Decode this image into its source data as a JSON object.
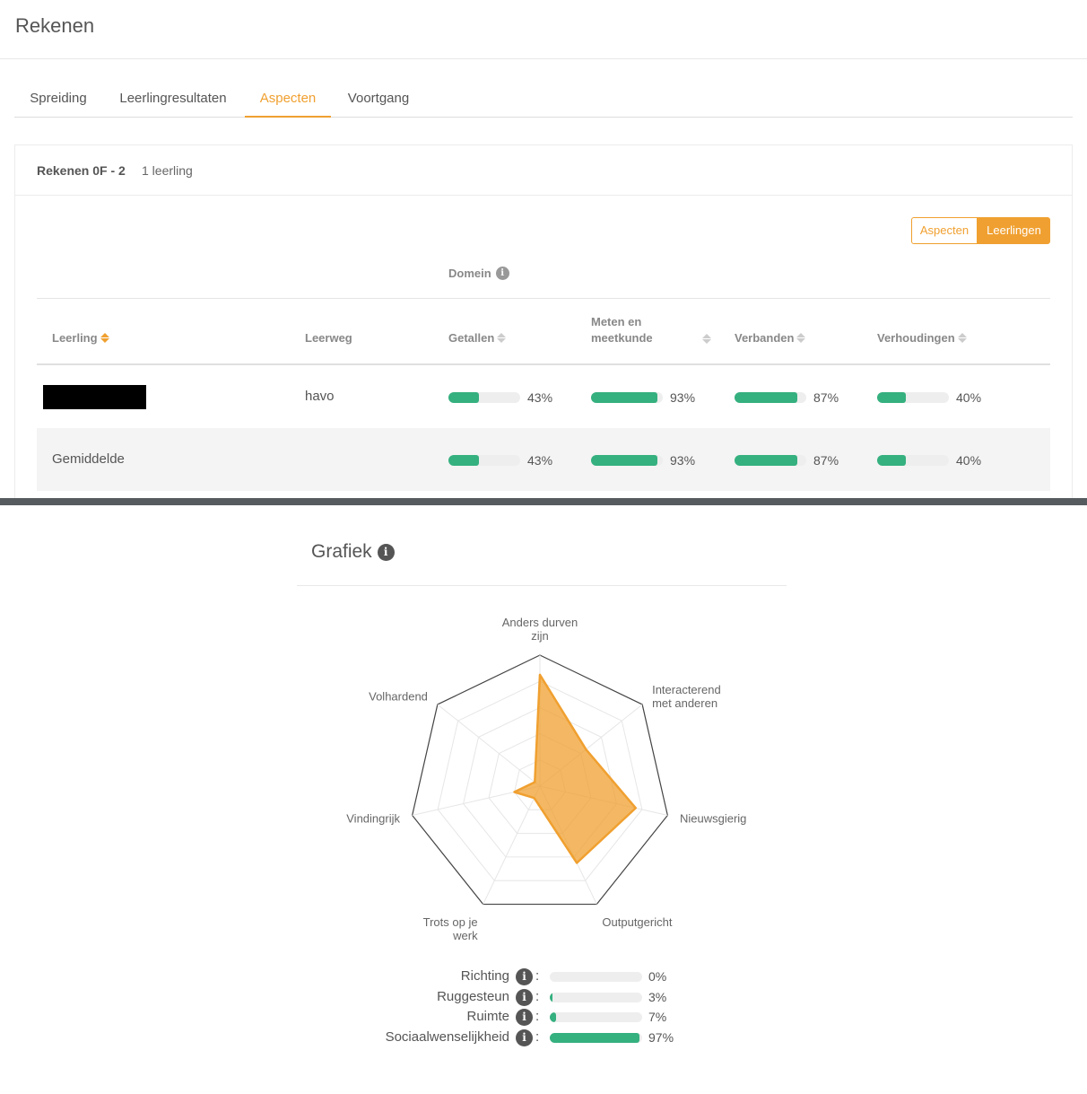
{
  "app": {
    "title": "Rekenen"
  },
  "tabs": [
    {
      "label": "Spreiding",
      "active": false
    },
    {
      "label": "Leerlingresultaten",
      "active": false
    },
    {
      "label": "Aspecten",
      "active": true
    },
    {
      "label": "Voortgang",
      "active": false
    }
  ],
  "card": {
    "title": "Rekenen 0F - 2",
    "subtitle": "1 leerling",
    "toggle": {
      "left": "Aspecten",
      "right": "Leerlingen",
      "selected": "Leerlingen"
    },
    "domein_label": "Domein",
    "columns": {
      "leerling": "Leerling",
      "leerweg": "Leerweg",
      "getallen": "Getallen",
      "meten": "Meten en meetkunde",
      "verbanden": "Verbanden",
      "verhoudingen": "Verhoudingen"
    },
    "rows": [
      {
        "name": "",
        "redacted": true,
        "leerweg": "havo",
        "getallen": 43,
        "meten": 93,
        "verbanden": 87,
        "verhoudingen": 40,
        "getallen_text": "43%",
        "meten_text": "93%",
        "verbanden_text": "87%",
        "verhoudingen_text": "40%"
      },
      {
        "name": "Gemiddelde",
        "redacted": false,
        "leerweg": "",
        "getallen": 43,
        "meten": 93,
        "verbanden": 87,
        "verhoudingen": 40,
        "getallen_text": "43%",
        "meten_text": "93%",
        "verbanden_text": "87%",
        "verhoudingen_text": "40%"
      }
    ]
  },
  "grafiek": {
    "title": "Grafiek",
    "chart_data": {
      "type": "radar",
      "axes": [
        "Anders durven zijn",
        "Interacterend met anderen",
        "Nieuwsgierig",
        "Outputgericht",
        "Trots op je werk",
        "Vindingrijk",
        "Volhardend"
      ],
      "axis_labels": [
        [
          "Anders durven",
          "zijn"
        ],
        [
          "Interacterend",
          "met anderen"
        ],
        [
          "Nieuwsgierig"
        ],
        [
          "Outputgericht"
        ],
        [
          "Trots op je",
          "werk"
        ],
        [
          "Vindingrijk"
        ],
        [
          "Volhardend"
        ]
      ],
      "values": [
        0.85,
        0.45,
        0.75,
        0.65,
        0.1,
        0.2,
        0.05
      ],
      "max": 1,
      "rings": 5,
      "color": "#f0a030"
    }
  },
  "scores": [
    {
      "label": "Richting",
      "value": 0,
      "text": "0%"
    },
    {
      "label": "Ruggesteun",
      "value": 3,
      "text": "3%"
    },
    {
      "label": "Ruimte",
      "value": 7,
      "text": "7%"
    },
    {
      "label": "Sociaalwenselijkheid",
      "value": 97,
      "text": "97%"
    }
  ],
  "colors": {
    "accent": "#f0a030",
    "bar": "#35b07f",
    "track": "#eeeeee"
  }
}
